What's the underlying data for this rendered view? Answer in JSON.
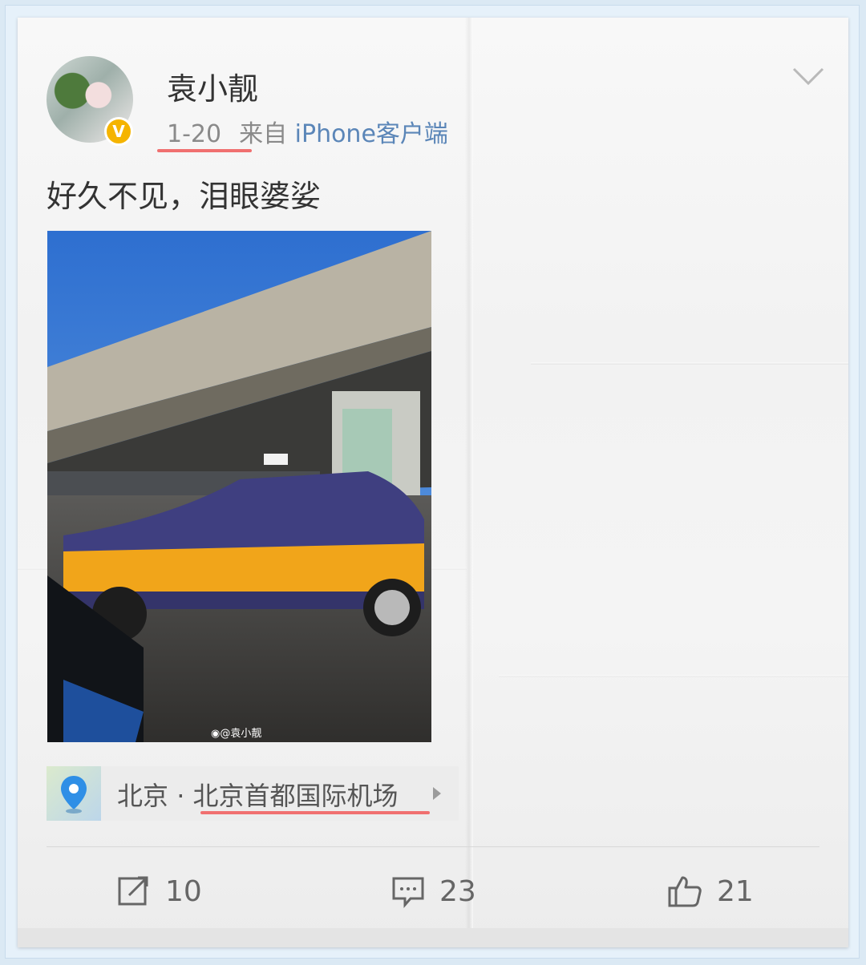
{
  "post": {
    "username": "袁小靓",
    "date": "1-20",
    "source_prefix": "来自",
    "source": "iPhone客户端",
    "verified_badge": "V",
    "text": "好久不见，泪眼婆娑",
    "image_watermark": "@袁小靓",
    "location": {
      "city": "北京",
      "separator": " · ",
      "place": "北京首都国际机场"
    }
  },
  "actions": {
    "repost_count": "10",
    "comment_count": "23",
    "like_count": "21"
  },
  "colors": {
    "accent_link": "#5b86b8",
    "annotation_underline": "#f07070",
    "verified_badge": "#f5b400",
    "location_pin": "#2f8fe6"
  },
  "icons": [
    "chevron-down-icon",
    "repost-icon",
    "comment-icon",
    "like-icon",
    "location-pin-icon",
    "weibo-logo-icon"
  ]
}
